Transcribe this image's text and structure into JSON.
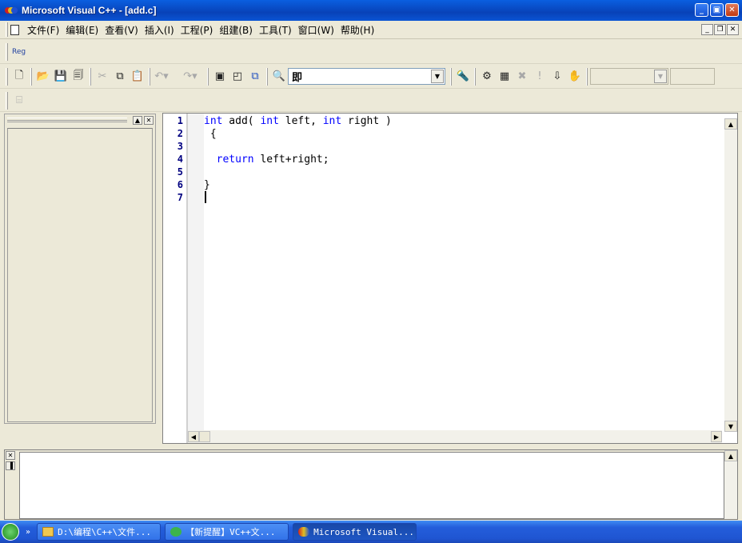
{
  "window": {
    "title": "Microsoft Visual C++ - [add.c]",
    "controls": [
      "minimize",
      "maximize",
      "close"
    ]
  },
  "menubar": {
    "items": [
      {
        "label": "文件(F)"
      },
      {
        "label": "编辑(E)"
      },
      {
        "label": "查看(V)"
      },
      {
        "label": "插入(I)"
      },
      {
        "label": "工程(P)"
      },
      {
        "label": "组建(B)"
      },
      {
        "label": "工具(T)"
      },
      {
        "label": "窗口(W)"
      },
      {
        "label": "帮助(H)"
      }
    ]
  },
  "toolbar_reg": {
    "label": "Reg"
  },
  "toolbar_main": {
    "find_combo_value": "即",
    "icons": [
      "new-file-icon",
      "open-folder-icon",
      "save-icon",
      "save-all-icon",
      "cut-icon",
      "copy-icon",
      "paste-icon",
      "undo-icon",
      "redo-icon",
      "workspace-icon",
      "output-icon",
      "window-list-icon",
      "find-in-files-icon",
      "find-icon",
      "compile-icon",
      "build-icon",
      "stop-build-icon",
      "execute-icon",
      "go-icon",
      "breakpoint-icon"
    ]
  },
  "editor": {
    "line_numbers": [
      "1",
      "2",
      "3",
      "4",
      "5",
      "6",
      "7"
    ],
    "lines": [
      [
        {
          "t": "int",
          "kw": true
        },
        {
          "t": " add( "
        },
        {
          "t": "int",
          "kw": true
        },
        {
          "t": " left, "
        },
        {
          "t": "int",
          "kw": true
        },
        {
          "t": " right )"
        }
      ],
      [
        {
          "t": " {"
        }
      ],
      [],
      [
        {
          "t": "  "
        },
        {
          "t": "return",
          "kw": true
        },
        {
          "t": " left+right;"
        }
      ],
      [],
      [
        {
          "t": "}"
        }
      ],
      []
    ]
  },
  "taskbar": {
    "tasks": [
      {
        "label": "D:\\编程\\C++\\文件..."
      },
      {
        "label": "【新提醒】VC++文..."
      },
      {
        "label": "Microsoft Visual..."
      }
    ],
    "more": "»"
  },
  "colors": {
    "keyword": "#0000ff",
    "line_number": "#000080",
    "titlebar": "#0842b8"
  }
}
